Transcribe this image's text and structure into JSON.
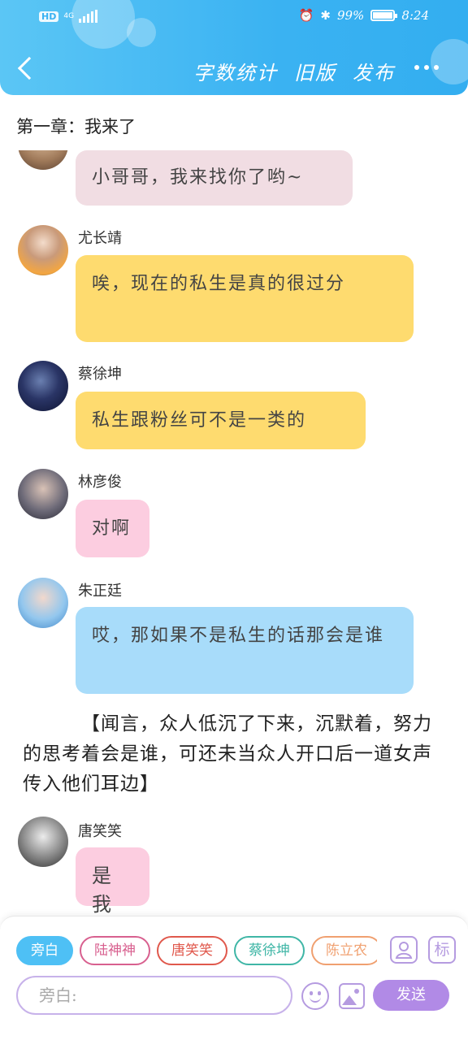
{
  "status_bar": {
    "hd": "HD",
    "network": "4G",
    "battery": "99%",
    "battery_level": 0.99,
    "time": "8:24"
  },
  "header": {
    "actions": [
      "字数统计",
      "旧版",
      "发布"
    ]
  },
  "chapter_title": "第一章：我来了",
  "messages": [
    {
      "name": "",
      "text": "小哥哥，我来找你了哟~",
      "bubble_color": "#f1dde3"
    },
    {
      "name": "尤长靖",
      "text": "唉，现在的私生是真的很过分",
      "bubble_color": "#fedb6f"
    },
    {
      "name": "蔡徐坤",
      "text": "私生跟粉丝可不是一类的",
      "bubble_color": "#fedb6f"
    },
    {
      "name": "林彦俊",
      "text": "对啊",
      "bubble_color": "#fccde0"
    },
    {
      "name": "朱正廷",
      "text": "哎，那如果不是私生的话那会是谁",
      "bubble_color": "#a8dcfa"
    }
  ],
  "narration": "【闻言，众人低沉了下来，沉默着，努力的思考着会是谁，可还未当众人开口后一道女声传入他们耳边】",
  "last_message": {
    "name": "唐笑笑",
    "text": "是我",
    "bubble_color": "#fccde0"
  },
  "bottom": {
    "chips": [
      {
        "label": "旁白",
        "color": "#4ec0f5",
        "active": true
      },
      {
        "label": "陆神神",
        "color": "#d8608f",
        "active": false
      },
      {
        "label": "唐笑笑",
        "color": "#e0584c",
        "active": false
      },
      {
        "label": "蔡徐坤",
        "color": "#3fb6a6",
        "active": false
      },
      {
        "label": "陈立农",
        "color": "#f0a070",
        "active": false
      }
    ],
    "side_icon_tag": "标",
    "input_placeholder": "旁白:",
    "send_label": "发送"
  }
}
